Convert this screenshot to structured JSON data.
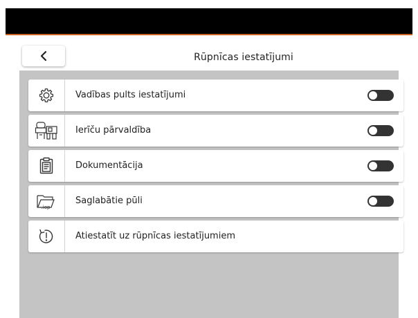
{
  "header": {
    "title": "Rūpnīcas iestatījumi",
    "back_icon": "chevron-left-icon"
  },
  "items": [
    {
      "label": "Vadības pults iestatījumi",
      "icon": "gear-icon",
      "has_toggle": true,
      "toggle_on": false
    },
    {
      "label": "Ierīču pārvaldība",
      "icon": "tractor-implement-icon",
      "has_toggle": true,
      "toggle_on": false
    },
    {
      "label": "Dokumentācija",
      "icon": "clipboard-icon",
      "has_toggle": true,
      "toggle_on": false
    },
    {
      "label": "Saglabātie pūli",
      "icon": "folder-iop-icon",
      "icon_text": ".iop",
      "has_toggle": true,
      "toggle_on": false
    },
    {
      "label": "Atiestatīt uz rūpnīcas iestatījumiem",
      "icon": "reset-icon",
      "has_toggle": false
    }
  ],
  "colors": {
    "accent": "#c8641e",
    "panel": "#c4c4c4",
    "toggle": "#333333"
  }
}
